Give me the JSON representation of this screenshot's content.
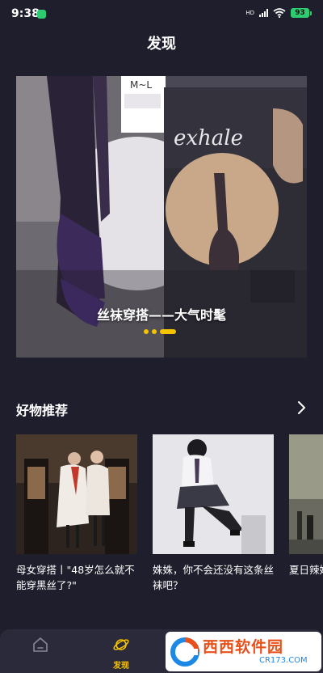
{
  "status_bar": {
    "time": "9:38",
    "network": "HD",
    "battery": "93"
  },
  "header": {
    "title": "发现"
  },
  "banner": {
    "caption": "丝袜穿搭——大气时髦",
    "package_size": "M~L",
    "brand": "exhale",
    "slide_count": 3,
    "active_slide": 3
  },
  "section": {
    "title": "好物推荐"
  },
  "cards": [
    {
      "title": "母女穿搭丨\"48岁怎么就不能穿黑丝了?\""
    },
    {
      "title": "姝姝，你不会还没有这条丝袜吧？"
    },
    {
      "title": "夏日辣妹搭，这"
    }
  ],
  "tab_bar": {
    "tabs": [
      {
        "label": ""
      },
      {
        "label": "发现"
      }
    ]
  },
  "watermark": {
    "name": "西西软件园",
    "url": "CR173.COM"
  },
  "colors": {
    "background": "#1f1e2c",
    "accent": "#f5c400",
    "tab_bar": "#2b2a3a"
  }
}
